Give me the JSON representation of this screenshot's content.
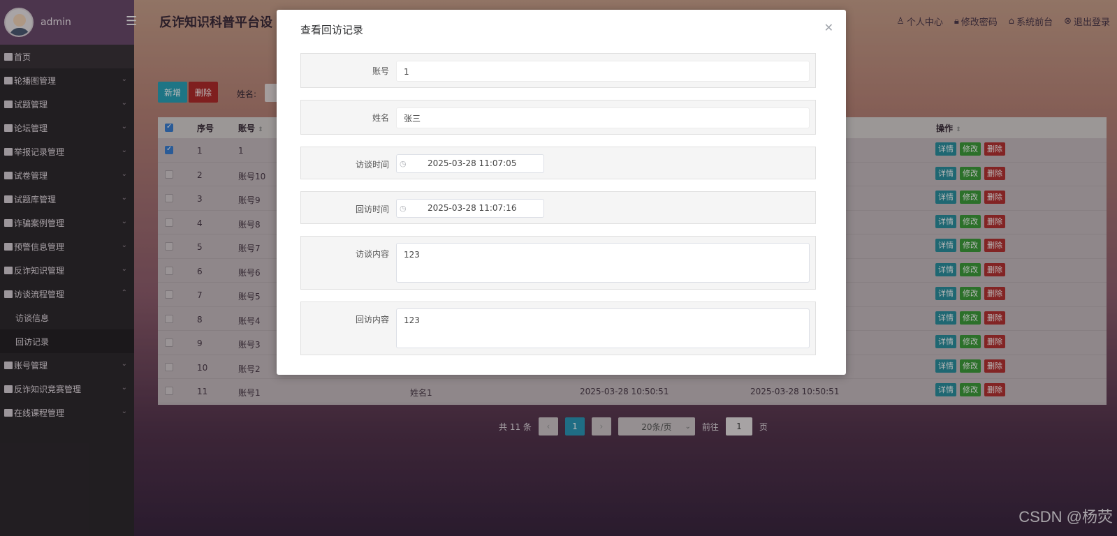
{
  "sidebar": {
    "user": "admin",
    "menu": [
      {
        "label": "首页",
        "type": "home"
      },
      {
        "label": "轮播图管理"
      },
      {
        "label": "试题管理"
      },
      {
        "label": "论坛管理"
      },
      {
        "label": "举报记录管理"
      },
      {
        "label": "试卷管理"
      },
      {
        "label": "试题库管理"
      },
      {
        "label": "诈骗案例管理"
      },
      {
        "label": "预警信息管理"
      },
      {
        "label": "反诈知识管理"
      },
      {
        "label": "访谈流程管理",
        "expanded": true
      },
      {
        "label": "访谈信息",
        "type": "sub"
      },
      {
        "label": "回访记录",
        "type": "sub",
        "active": true
      },
      {
        "label": "账号管理"
      },
      {
        "label": "反诈知识竞赛管理"
      },
      {
        "label": "在线课程管理"
      }
    ]
  },
  "header": {
    "title": "反诈知识科普平台设",
    "links": [
      "个人中心",
      "修改密码",
      "系统前台",
      "退出登录"
    ]
  },
  "toolbar": {
    "add_label": "新增",
    "delete_label": "删除",
    "search_label": "姓名:"
  },
  "table": {
    "headers": {
      "index": "序号",
      "account": "账号",
      "ops": "操作"
    },
    "rows": [
      {
        "index": "1",
        "account": "1",
        "checked": true
      },
      {
        "index": "2",
        "account": "账号10"
      },
      {
        "index": "3",
        "account": "账号9"
      },
      {
        "index": "4",
        "account": "账号8"
      },
      {
        "index": "5",
        "account": "账号7"
      },
      {
        "index": "6",
        "account": "账号6"
      },
      {
        "index": "7",
        "account": "账号5"
      },
      {
        "index": "8",
        "account": "账号4"
      },
      {
        "index": "9",
        "account": "账号3"
      },
      {
        "index": "10",
        "account": "账号2"
      },
      {
        "index": "11",
        "account": "账号1",
        "name": "姓名1",
        "visit_time": "2025-03-28 10:50:51",
        "revisit_time": "2025-03-28 10:50:51"
      }
    ],
    "op_labels": {
      "detail": "详情",
      "edit": "修改",
      "delete": "删除"
    }
  },
  "pagination": {
    "total": "共 11 条",
    "current": "1",
    "page_size": "20条/页",
    "goto_label": "前往",
    "goto_value": "1",
    "page_suffix": "页"
  },
  "modal": {
    "title": "查看回访记录",
    "fields": {
      "account": {
        "label": "账号",
        "value": "1"
      },
      "name": {
        "label": "姓名",
        "value": "张三"
      },
      "visit_time": {
        "label": "访谈时间",
        "value": "2025-03-28 11:07:05"
      },
      "revisit_time": {
        "label": "回访时间",
        "value": "2025-03-28 11:07:16"
      },
      "visit_content": {
        "label": "访谈内容",
        "value": "123"
      },
      "revisit_content": {
        "label": "回访内容",
        "value": "123"
      }
    }
  },
  "watermark": "CSDN @杨荧"
}
